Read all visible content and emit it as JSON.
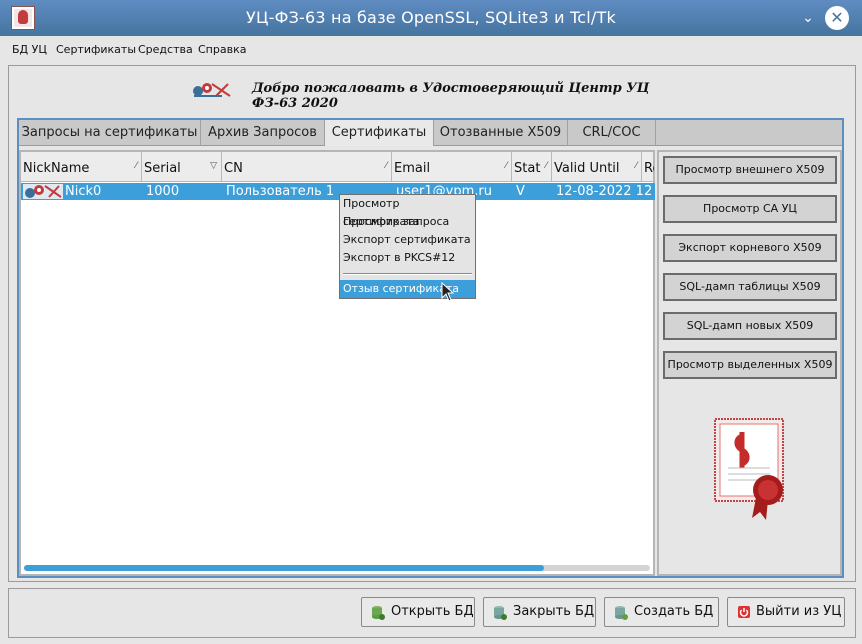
{
  "window": {
    "title": "УЦ-ФЗ-63 на базе OpenSSL, SQLite3 и Tcl/Tk"
  },
  "menu": [
    "БД УЦ",
    "Сертификаты",
    "Средства",
    "Справка"
  ],
  "welcome": "Добро пожаловать в Удостоверяющий Центр УЦ ФЗ-63 2020",
  "tabs": [
    {
      "label": "Запросы на сертификаты",
      "active": false
    },
    {
      "label": "Архив Запросов",
      "active": false
    },
    {
      "label": "Сертификаты",
      "active": true
    },
    {
      "label": "Отозванные X509",
      "active": false
    },
    {
      "label": "CRL/COC",
      "active": false
    }
  ],
  "table": {
    "columns": [
      {
        "label": "NickName",
        "sort": "⁄"
      },
      {
        "label": "Serial",
        "sort": "▽"
      },
      {
        "label": "CN",
        "sort": "⁄"
      },
      {
        "label": "Email",
        "sort": "⁄"
      },
      {
        "label": "Stat",
        "sort": "⁄"
      },
      {
        "label": "Valid Until",
        "sort": "⁄"
      },
      {
        "label": "Re",
        "sort": ""
      }
    ],
    "rows": [
      {
        "nick": "Nick0",
        "serial": "1000",
        "cn": "Пользователь 1",
        "email": "user1@vpm.ru",
        "stat": "V",
        "valid": "12-08-2022 12"
      }
    ],
    "scroll_fraction": 0.83
  },
  "context_menu": [
    "Просмотр сертификата",
    "Просмотр запроса",
    "Экспорт сертификата",
    "Экспорт в PKCS#12",
    "Отзыв сертификата"
  ],
  "side_buttons": [
    "Просмотр внешнего X509",
    "Просмотр CA УЦ",
    "Экспорт корневого X509",
    "SQL-дамп таблицы X509",
    "SQL-дамп новых X509",
    "Просмотр выделенных X509"
  ],
  "bottom_buttons": [
    {
      "label": "Открыть БД",
      "icon": "database-open-icon"
    },
    {
      "label": "Закрыть БД",
      "icon": "database-close-icon"
    },
    {
      "label": "Создать БД",
      "icon": "database-create-icon"
    },
    {
      "label": "Выйти из УЦ",
      "icon": "exit-icon"
    }
  ],
  "colors": {
    "accent": "#3c9fd9",
    "titlebar": "#4f7fb2",
    "tab_border": "#5b8fc0"
  }
}
